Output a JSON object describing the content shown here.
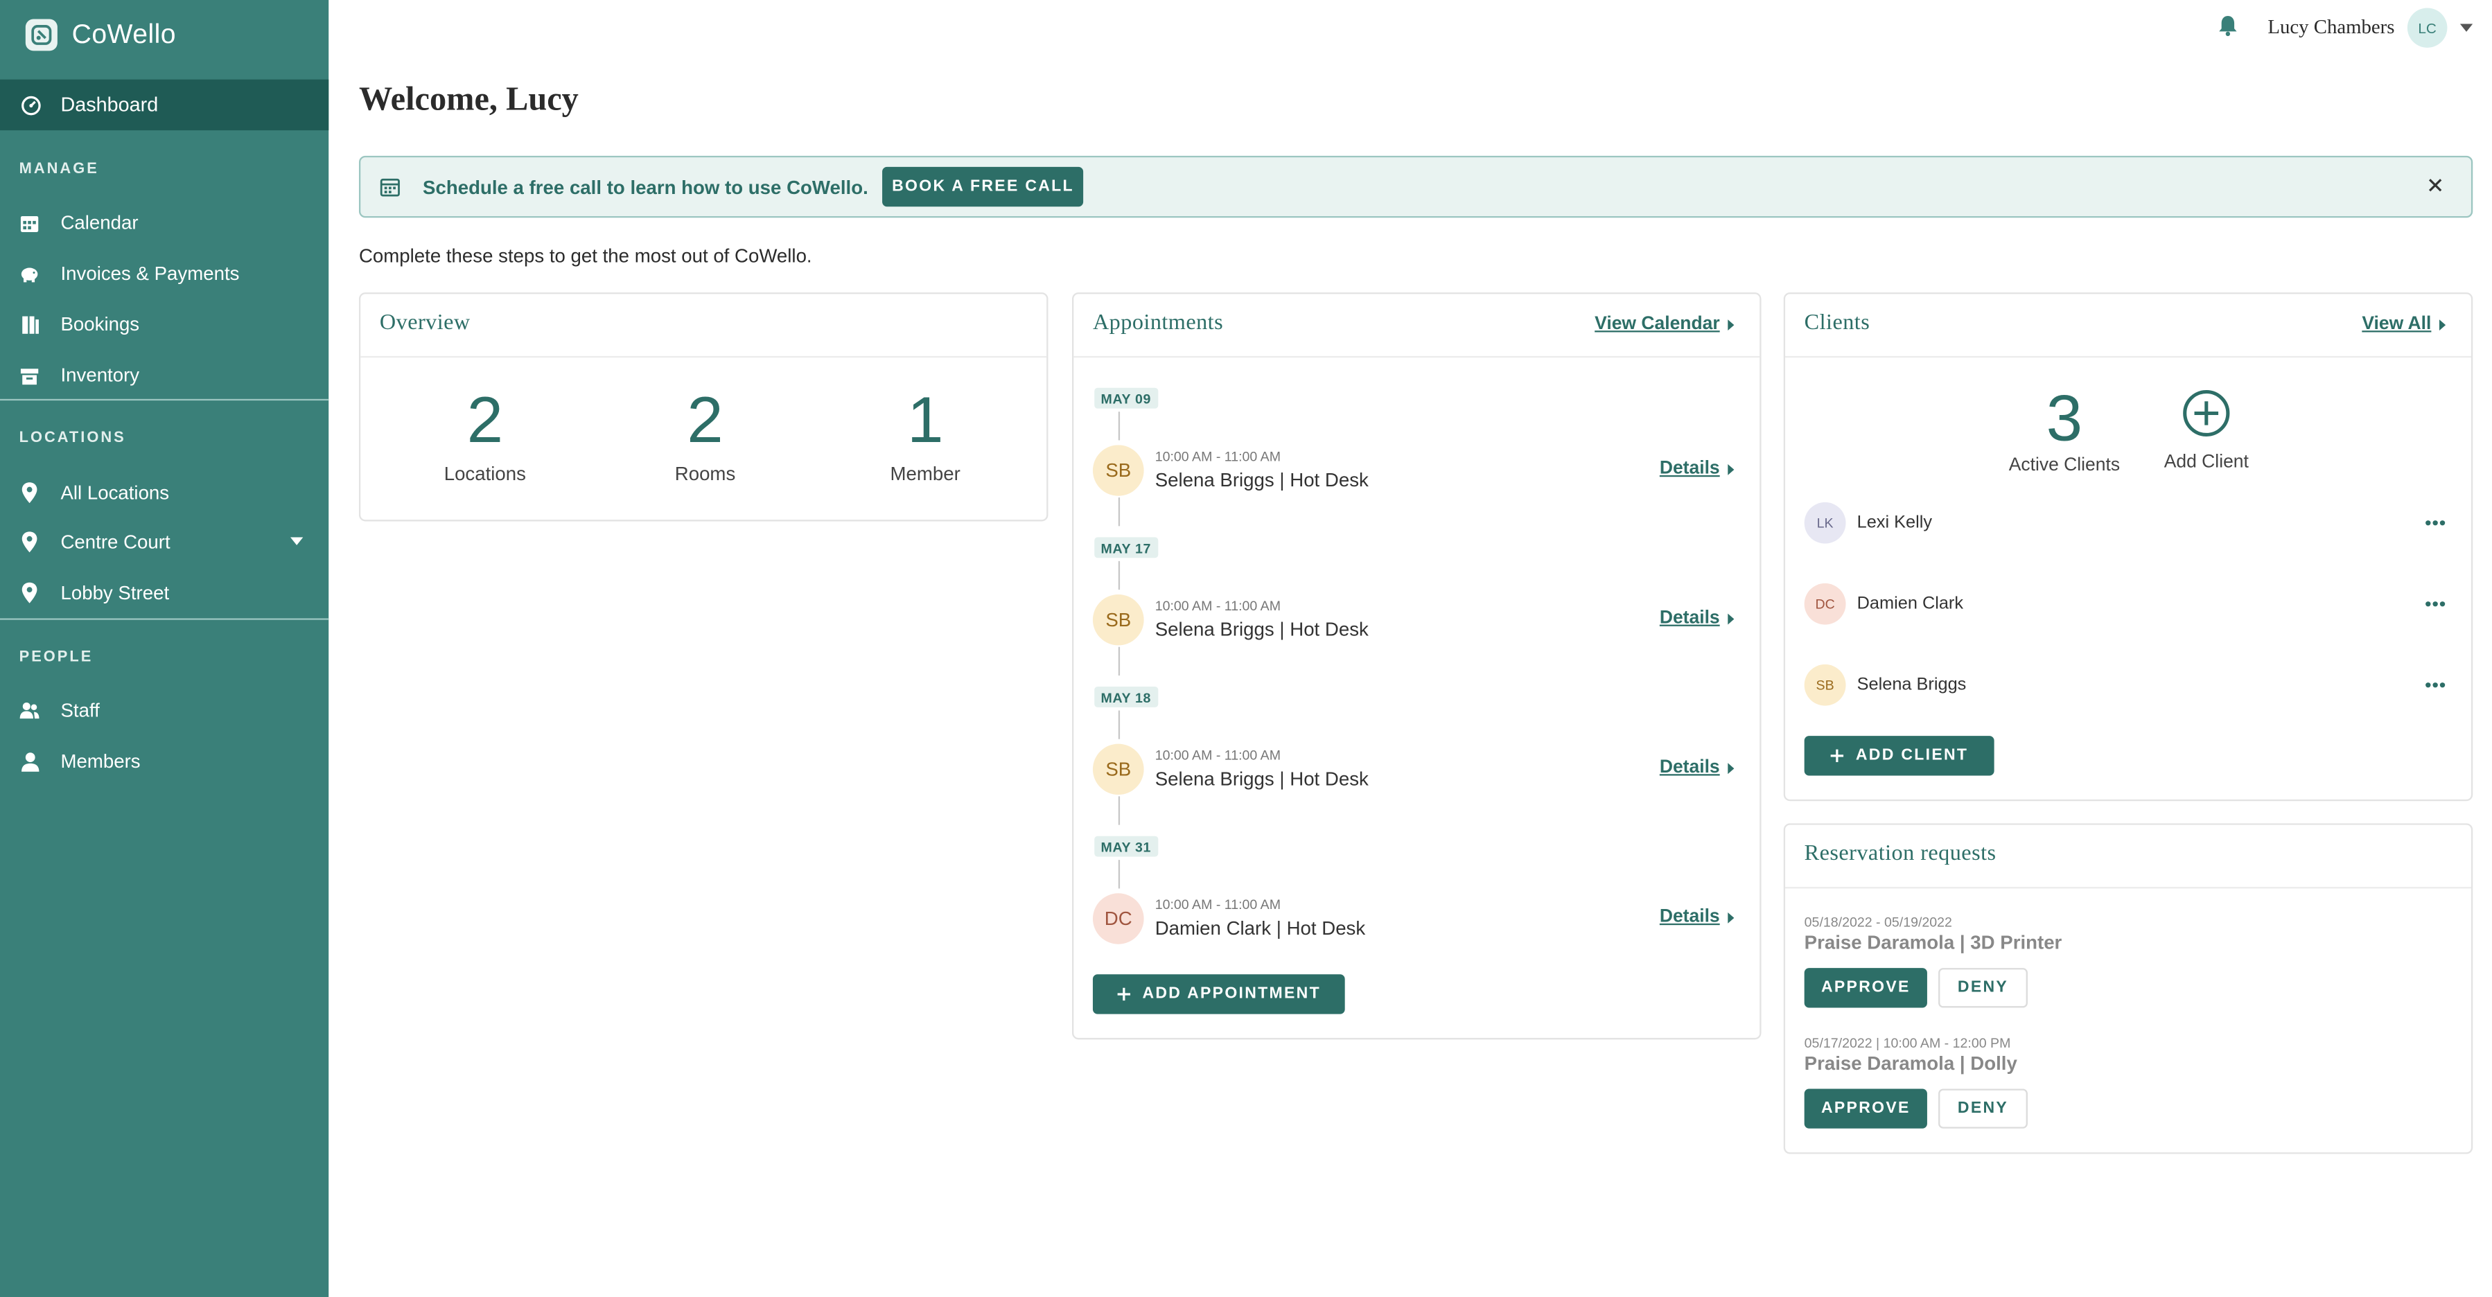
{
  "app": {
    "name": "CoWello"
  },
  "colors": {
    "primary": "#3a8079",
    "primary_dark": "#2d6e67",
    "sidebar_active": "#1f5b55",
    "banner_bg": "#e9f3f1"
  },
  "sidebar": {
    "active_item": {
      "label": "Dashboard",
      "icon": "dashboard-icon"
    },
    "sections": [
      {
        "label": "MANAGE",
        "items": [
          {
            "label": "Calendar",
            "icon": "calendar-icon"
          },
          {
            "label": "Invoices & Payments",
            "icon": "piggy-bank-icon"
          },
          {
            "label": "Bookings",
            "icon": "bookings-icon"
          },
          {
            "label": "Inventory",
            "icon": "inventory-icon"
          }
        ]
      },
      {
        "label": "LOCATIONS",
        "items": [
          {
            "label": "All Locations",
            "icon": "map-pin-icon"
          },
          {
            "label": "Centre Court",
            "icon": "map-pin-icon"
          },
          {
            "label": "Lobby Street",
            "icon": "map-pin-icon"
          }
        ]
      },
      {
        "label": "PEOPLE",
        "items": [
          {
            "label": "Staff",
            "icon": "staff-icon"
          },
          {
            "label": "Members",
            "icon": "member-icon"
          }
        ]
      }
    ]
  },
  "topbar": {
    "user_name": "Lucy Chambers",
    "user_initials": "LC"
  },
  "main": {
    "welcome": "Welcome, Lucy",
    "banner": {
      "text": "Schedule a free call to learn how to use CoWello.",
      "button": "BOOK A FREE CALL"
    },
    "intro": "Complete these steps to get the most out of CoWello."
  },
  "overview": {
    "title": "Overview",
    "stats": [
      {
        "value": "2",
        "label": "Locations"
      },
      {
        "value": "2",
        "label": "Rooms"
      },
      {
        "value": "1",
        "label": "Member"
      }
    ]
  },
  "appointments": {
    "title": "Appointments",
    "link": "View Calendar",
    "details_label": "Details",
    "add_button": "ADD APPOINTMENT",
    "items": [
      {
        "date": "MAY 09",
        "initials": "SB",
        "time": "10:00 AM - 11:00 AM",
        "title": "Selena Briggs | Hot Desk"
      },
      {
        "date": "MAY 17",
        "initials": "SB",
        "time": "10:00 AM - 11:00 AM",
        "title": "Selena Briggs | Hot Desk"
      },
      {
        "date": "MAY 18",
        "initials": "SB",
        "time": "10:00 AM - 11:00 AM",
        "title": "Selena Briggs | Hot Desk"
      },
      {
        "date": "MAY 31",
        "initials": "DC",
        "time": "10:00 AM - 11:00 AM",
        "title": "Damien Clark | Hot Desk"
      }
    ]
  },
  "clients": {
    "title": "Clients",
    "link": "View All",
    "active_count": "3",
    "active_label": "Active Clients",
    "add_label": "Add Client",
    "add_button": "ADD CLIENT",
    "list": [
      {
        "initials": "LK",
        "name": "Lexi Kelly"
      },
      {
        "initials": "DC",
        "name": "Damien Clark"
      },
      {
        "initials": "SB",
        "name": "Selena Briggs"
      }
    ]
  },
  "reservations": {
    "title": "Reservation requests",
    "approve_label": "APPROVE",
    "deny_label": "DENY",
    "items": [
      {
        "date": "05/18/2022 - 05/19/2022",
        "title": "Praise Daramola | 3D Printer"
      },
      {
        "date": "05/17/2022 | 10:00 AM - 12:00 PM",
        "title": "Praise Daramola | Dolly"
      }
    ]
  }
}
